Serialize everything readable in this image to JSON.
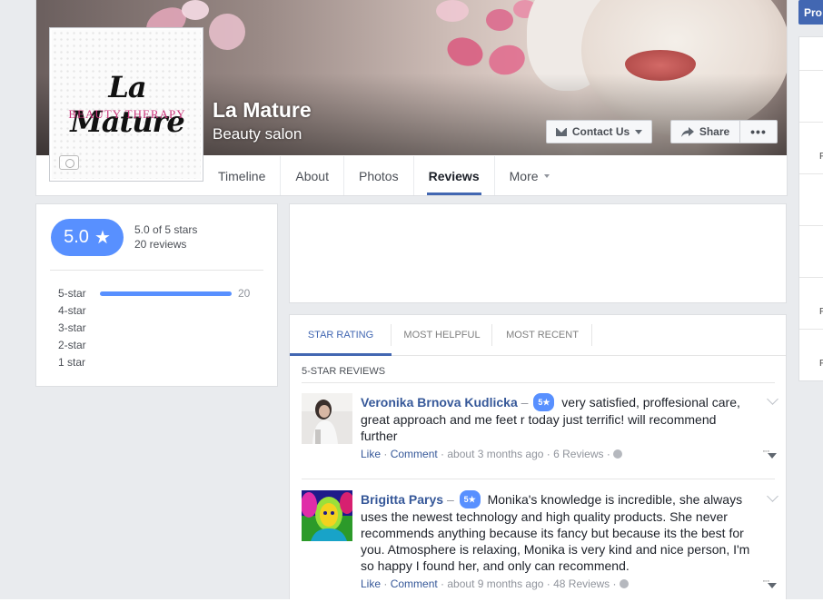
{
  "page": {
    "logo_title": "La Mature",
    "logo_subtitle": "BEAUTY THERAPY",
    "name": "La Mature",
    "category": "Beauty salon",
    "contact_label": "Contact Us",
    "share_label": "Share",
    "more_dots": "•••",
    "tabs": [
      {
        "label": "Timeline"
      },
      {
        "label": "About"
      },
      {
        "label": "Photos"
      },
      {
        "label": "Reviews",
        "active": true
      },
      {
        "label": "More"
      }
    ]
  },
  "right_column": {
    "button_label": "Pro",
    "letters": [
      "P",
      "F",
      "F",
      "F"
    ]
  },
  "rating": {
    "score": "5.0",
    "star_glyph": "★",
    "out_of": "5.0 of 5 stars",
    "count": "20 reviews",
    "distribution": [
      {
        "label": "5-star",
        "count": "20",
        "fraction": 1.0
      },
      {
        "label": "4-star",
        "count": "",
        "fraction": 0
      },
      {
        "label": "3-star",
        "count": "",
        "fraction": 0
      },
      {
        "label": "2-star",
        "count": "",
        "fraction": 0
      },
      {
        "label": "1 star",
        "count": "",
        "fraction": 0
      }
    ],
    "accent_color": "#5890ff"
  },
  "reviews": {
    "tabs": [
      {
        "label": "STAR RATING",
        "active": true
      },
      {
        "label": "MOST HELPFUL"
      },
      {
        "label": "MOST RECENT"
      }
    ],
    "section_title": "5-STAR REVIEWS",
    "items": [
      {
        "author": "Veronika Brnova Kudlicka",
        "dash": "–",
        "stars": "5★",
        "text": "very satisfied, proffesional care, great approach and me feet r today just terrific! will recommend further",
        "like": "Like",
        "comment": "Comment",
        "time": "about 3 months ago",
        "reviews_count": "6 Reviews"
      },
      {
        "author": "Brigitta Parys",
        "dash": "–",
        "stars": "5★",
        "text": "Monika's knowledge is incredible, she always uses the newest technology and high quality products. She never recommends anything because its fancy but because its the best for you. Atmosphere is relaxing, Monika is very kind and nice person, I'm so happy I found her, and only can recommend.",
        "like": "Like",
        "comment": "Comment",
        "time": "about 9 months ago",
        "reviews_count": "48 Reviews"
      }
    ]
  },
  "colors": {
    "facebook_blue": "#4267b2",
    "link_blue": "#365899",
    "background": "#e9ebee"
  }
}
